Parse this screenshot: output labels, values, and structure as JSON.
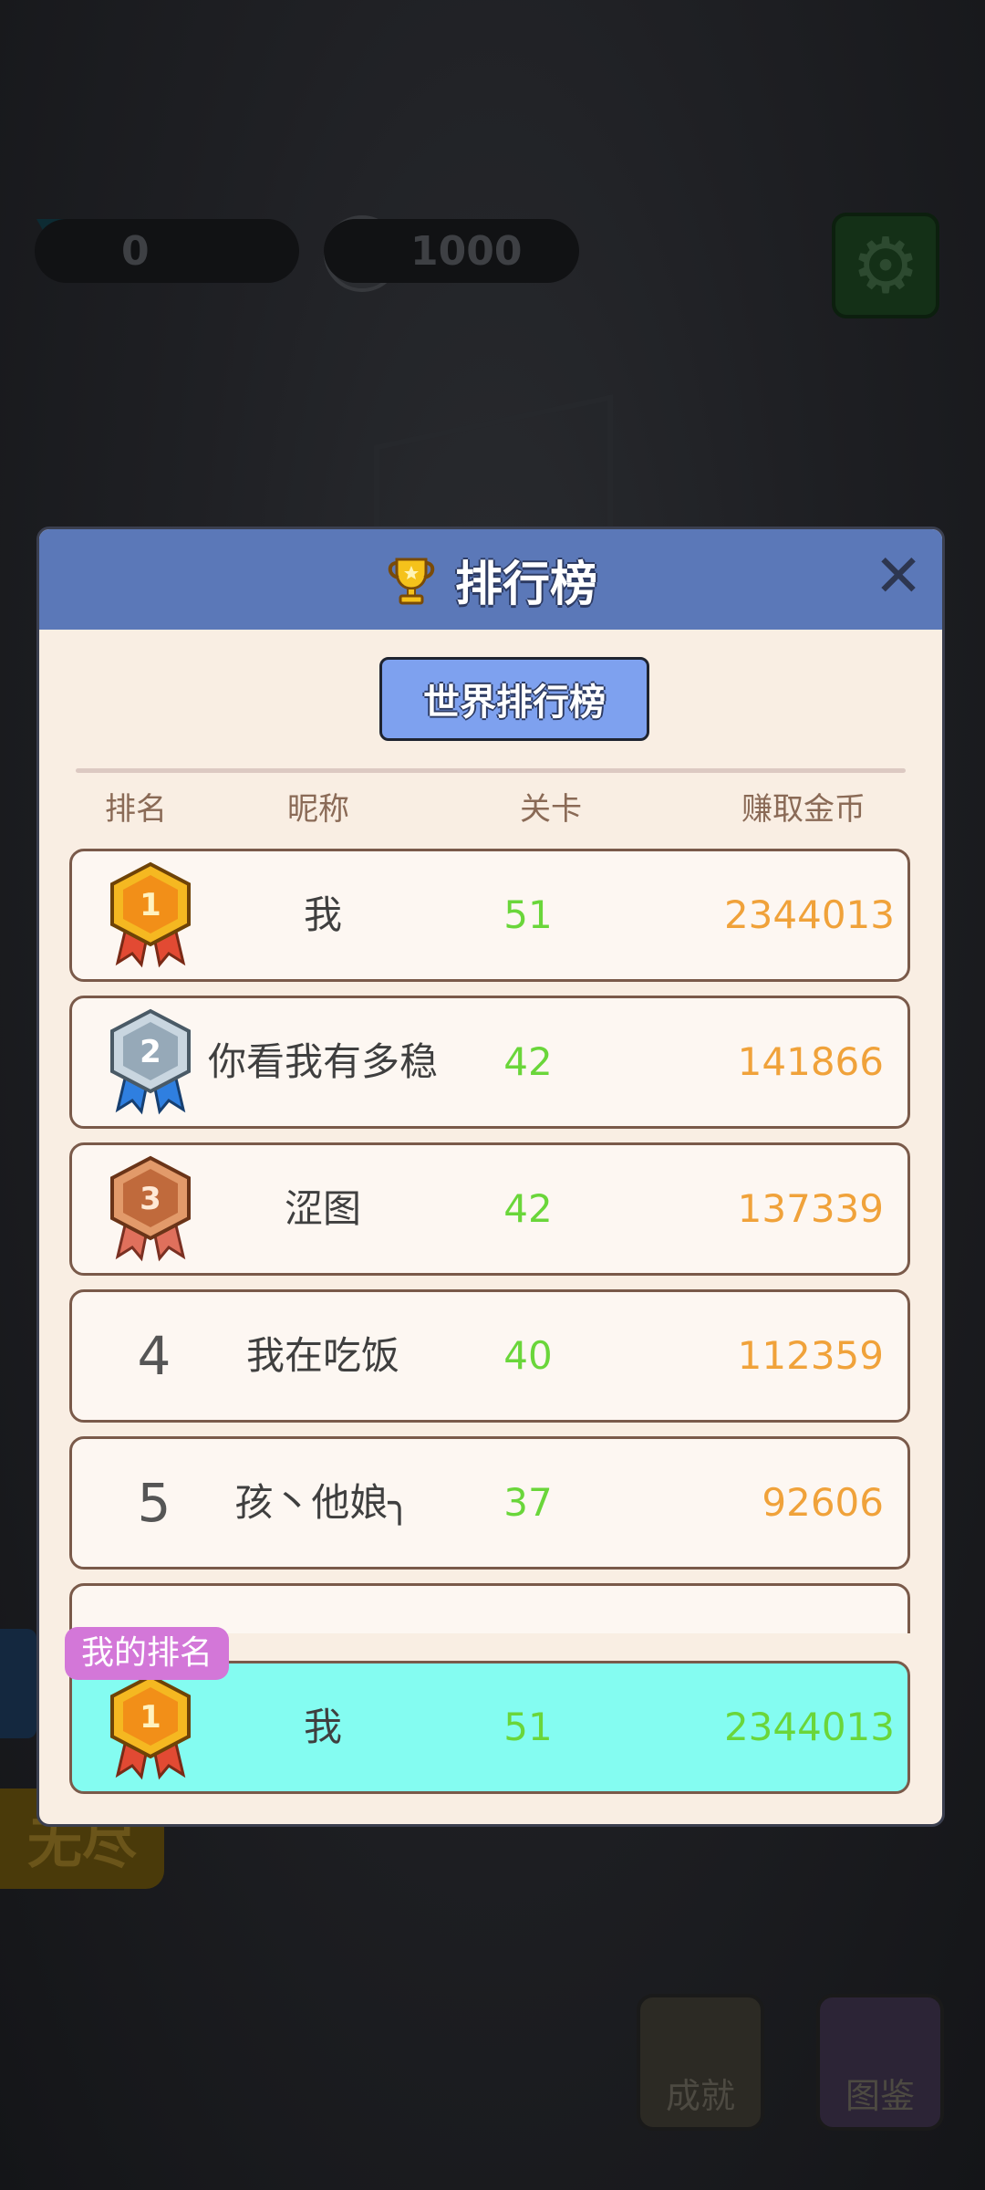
{
  "background": {
    "gems": "0",
    "coins": "1000",
    "achievements_label": "成就",
    "collection_label": "图鉴",
    "endless_label": "无尽"
  },
  "modal": {
    "title": "排行榜",
    "tab": "世界排行榜",
    "columns": {
      "rank": "排名",
      "name": "昵称",
      "level": "关卡",
      "coins": "赚取金币"
    },
    "rows": [
      {
        "rank": "1",
        "medal": "gold",
        "name": "我",
        "level": "51",
        "coins": "2344013"
      },
      {
        "rank": "2",
        "medal": "silver",
        "name": "你看我有多稳",
        "level": "42",
        "coins": "141866"
      },
      {
        "rank": "3",
        "medal": "bronze",
        "name": "涩图",
        "level": "42",
        "coins": "137339"
      },
      {
        "rank": "4",
        "medal": "",
        "name": "我在吃饭",
        "level": "40",
        "coins": "112359"
      },
      {
        "rank": "5",
        "medal": "",
        "name": "孩丶他娘╮",
        "level": "37",
        "coins": "92606"
      }
    ],
    "my_rank": {
      "tag": "我的排名",
      "rank": "1",
      "medal": "gold",
      "name": "我",
      "level": "51",
      "coins": "2344013"
    }
  },
  "colors": {
    "header": "#5b78b8",
    "tab": "#7ea1ef",
    "level_green": "#6ad63a",
    "coins_orange": "#f0a23a",
    "my_row": "#84fcf1",
    "my_tag": "#d377d8"
  }
}
